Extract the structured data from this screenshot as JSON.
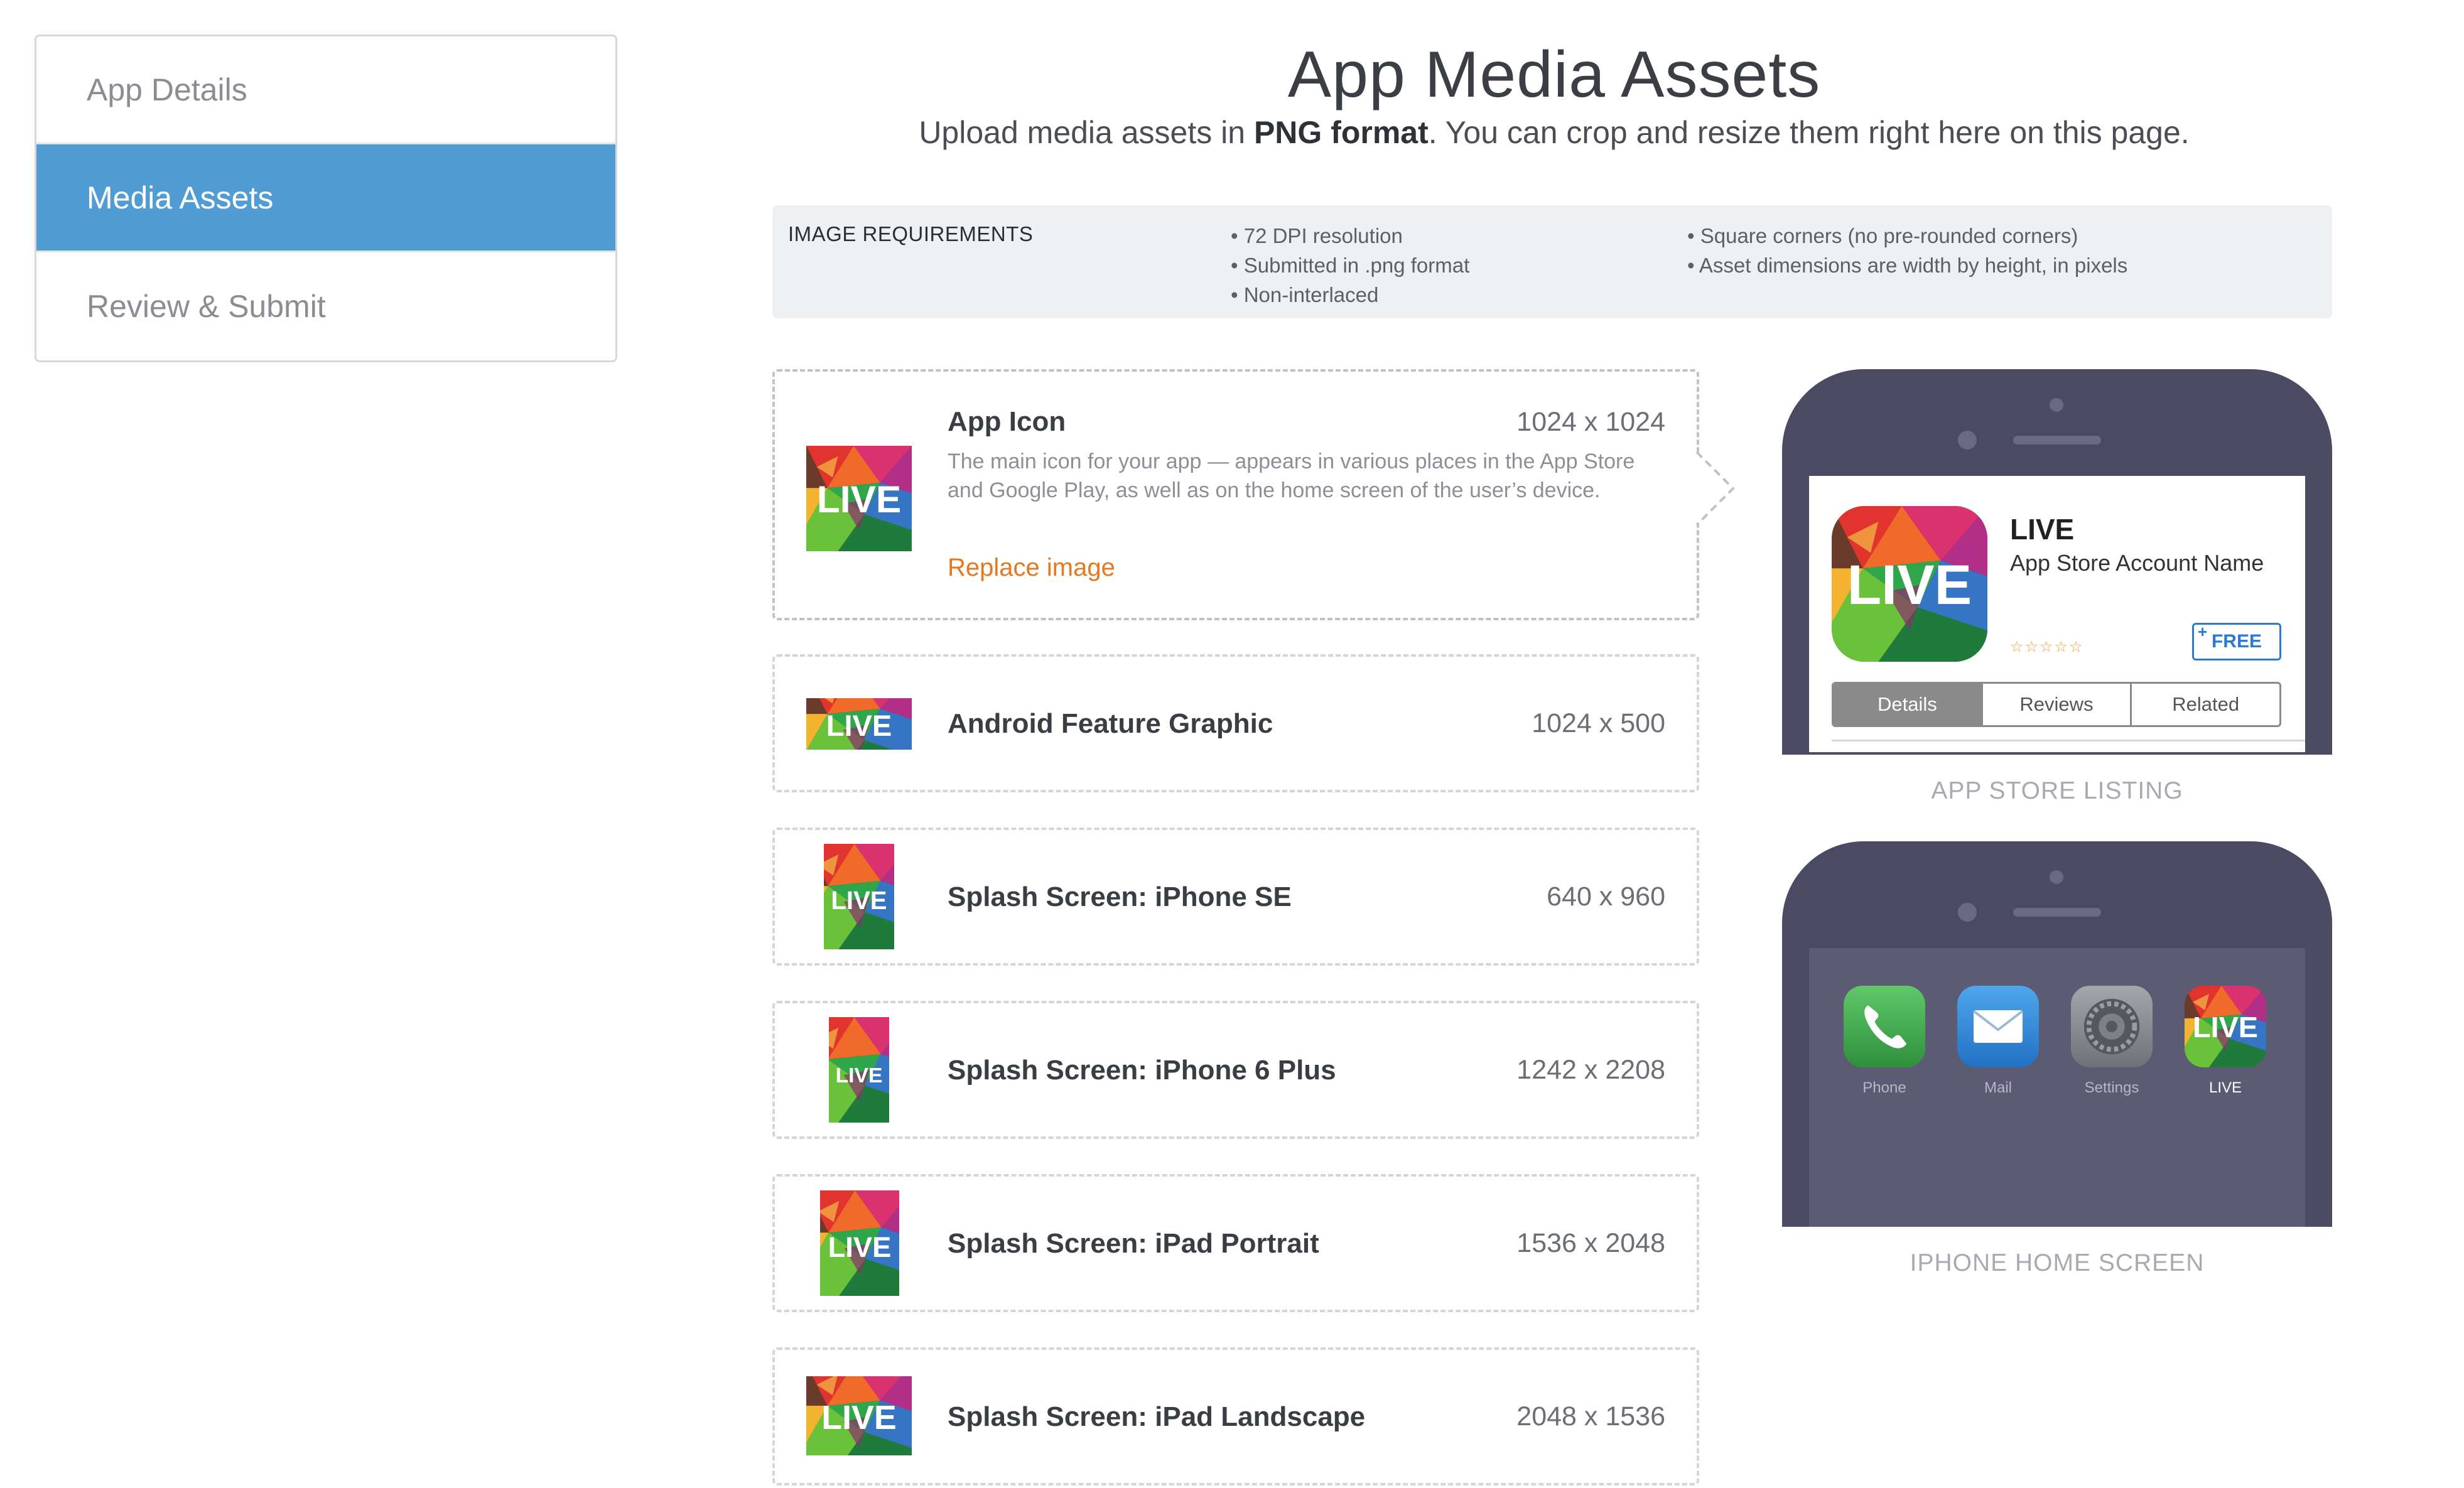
{
  "sidebar": {
    "items": [
      {
        "label": "App Details"
      },
      {
        "label": "Media Assets"
      },
      {
        "label": "Review & Submit"
      }
    ]
  },
  "header": {
    "title": "App Media Assets",
    "subtitle_pre": "Upload media assets in ",
    "subtitle_bold": "PNG format",
    "subtitle_post": ". You can crop and resize them right here on this page."
  },
  "requirements": {
    "title": "IMAGE REQUIREMENTS",
    "col1": [
      "• 72 DPI resolution",
      "• Submitted in .png format",
      "• Non-interlaced"
    ],
    "col2": [
      "• Square corners (no pre-rounded corners)",
      "• Asset dimensions are width by height, in pixels"
    ]
  },
  "assets": [
    {
      "name": "App Icon",
      "dimensions": "1024 x 1024",
      "description": "The main icon for your app — appears in various places in the App Store and Google Play, as well as on the home screen of the user’s device.",
      "action": "Replace image",
      "thumb_text": "LIVE"
    },
    {
      "name": "Android Feature Graphic",
      "dimensions": "1024 x 500",
      "thumb_text": "LIVE"
    },
    {
      "name": "Splash Screen: iPhone SE",
      "dimensions": "640 x 960",
      "thumb_text": "LIVE"
    },
    {
      "name": "Splash Screen: iPhone 6 Plus",
      "dimensions": "1242 x 2208",
      "thumb_text": "LIVE"
    },
    {
      "name": "Splash Screen: iPad Portrait",
      "dimensions": "1536 x 2048",
      "thumb_text": "LIVE"
    },
    {
      "name": "Splash Screen: iPad Landscape",
      "dimensions": "2048 x 1536",
      "thumb_text": "LIVE"
    }
  ],
  "store_preview": {
    "app_name": "LIVE",
    "account_name": "App Store Account Name",
    "rating_stars": "☆☆☆☆☆",
    "price_button": "FREE",
    "price_plus": "+",
    "tabs": [
      "Details",
      "Reviews",
      "Related"
    ],
    "caption": "APP STORE LISTING"
  },
  "home_preview": {
    "apps": [
      {
        "label": "Phone",
        "icon": "phone-icon"
      },
      {
        "label": "Mail",
        "icon": "mail-icon"
      },
      {
        "label": "Settings",
        "icon": "settings-icon"
      },
      {
        "label": "LIVE",
        "icon": "live-app-icon"
      }
    ],
    "caption": "IPHONE HOME SCREEN"
  },
  "colors": {
    "accent": "#519cd2",
    "link": "#e8771e",
    "phone_body": "#4b4a63",
    "free_button": "#2d7ad6"
  }
}
